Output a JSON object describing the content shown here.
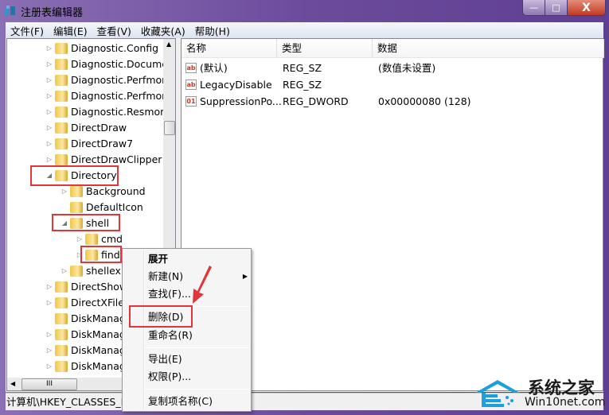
{
  "window": {
    "title": "注册表编辑器",
    "minimize": "—",
    "maximize": "□",
    "close": "X"
  },
  "menu": [
    "文件(F)",
    "编辑(E)",
    "查看(V)",
    "收藏夹(A)",
    "帮助(H)"
  ],
  "tree": [
    {
      "label": "Diagnostic.Config",
      "level": 0,
      "exp": "collapsed"
    },
    {
      "label": "Diagnostic.Documer",
      "level": 0,
      "exp": "collapsed"
    },
    {
      "label": "Diagnostic.Perfmon",
      "level": 0,
      "exp": "collapsed"
    },
    {
      "label": "Diagnostic.Perfmon",
      "level": 0,
      "exp": "collapsed"
    },
    {
      "label": "Diagnostic.Resmon.",
      "level": 0,
      "exp": "collapsed"
    },
    {
      "label": "DirectDraw",
      "level": 0,
      "exp": "collapsed"
    },
    {
      "label": "DirectDraw7",
      "level": 0,
      "exp": "collapsed"
    },
    {
      "label": "DirectDrawClipper",
      "level": 0,
      "exp": "collapsed"
    },
    {
      "label": "Directory",
      "level": 0,
      "exp": "expanded"
    },
    {
      "label": "Background",
      "level": 1,
      "exp": "collapsed"
    },
    {
      "label": "DefaultIcon",
      "level": 1,
      "exp": "none"
    },
    {
      "label": "shell",
      "level": 1,
      "exp": "expanded"
    },
    {
      "label": "cmd",
      "level": 2,
      "exp": "collapsed"
    },
    {
      "label": "find",
      "level": 2,
      "exp": "collapsed",
      "selected": true
    },
    {
      "label": "shellex",
      "level": 1,
      "exp": "collapsed"
    },
    {
      "label": "DirectShow",
      "level": 0,
      "exp": "collapsed"
    },
    {
      "label": "DirectXFile",
      "level": 0,
      "exp": "collapsed"
    },
    {
      "label": "DiskManag",
      "level": 0,
      "exp": "none"
    },
    {
      "label": "DiskManag",
      "level": 0,
      "exp": "collapsed"
    },
    {
      "label": "DiskManag",
      "level": 0,
      "exp": "collapsed"
    },
    {
      "label": "DiskManag",
      "level": 0,
      "exp": "collapsed"
    }
  ],
  "list": {
    "columns": [
      "名称",
      "类型",
      "数据"
    ],
    "rows": [
      {
        "icon": "string-value-icon",
        "name": "(默认)",
        "type": "REG_SZ",
        "data": "(数值未设置)"
      },
      {
        "icon": "string-value-icon",
        "name": "LegacyDisable",
        "type": "REG_SZ",
        "data": ""
      },
      {
        "icon": "dword-value-icon",
        "name": "SuppressionPo...",
        "type": "REG_DWORD",
        "data": "0x00000080 (128)"
      }
    ]
  },
  "status": "计算机\\HKEY_CLASSES_ROOT\\Directory\\shell\\find",
  "context_menu": {
    "expand": "展开",
    "new": "新建(N)",
    "find": "查找(F)...",
    "delete": "删除(D)",
    "rename": "重命名(R)",
    "export": "导出(E)",
    "permissions": "权限(P)...",
    "copy_key_name": "复制项名称(C)"
  },
  "watermark": {
    "brand": "系统之家",
    "site": "Win10net.com"
  },
  "colors": {
    "highlight": "#e0363a",
    "frame": "#6b4e98"
  }
}
